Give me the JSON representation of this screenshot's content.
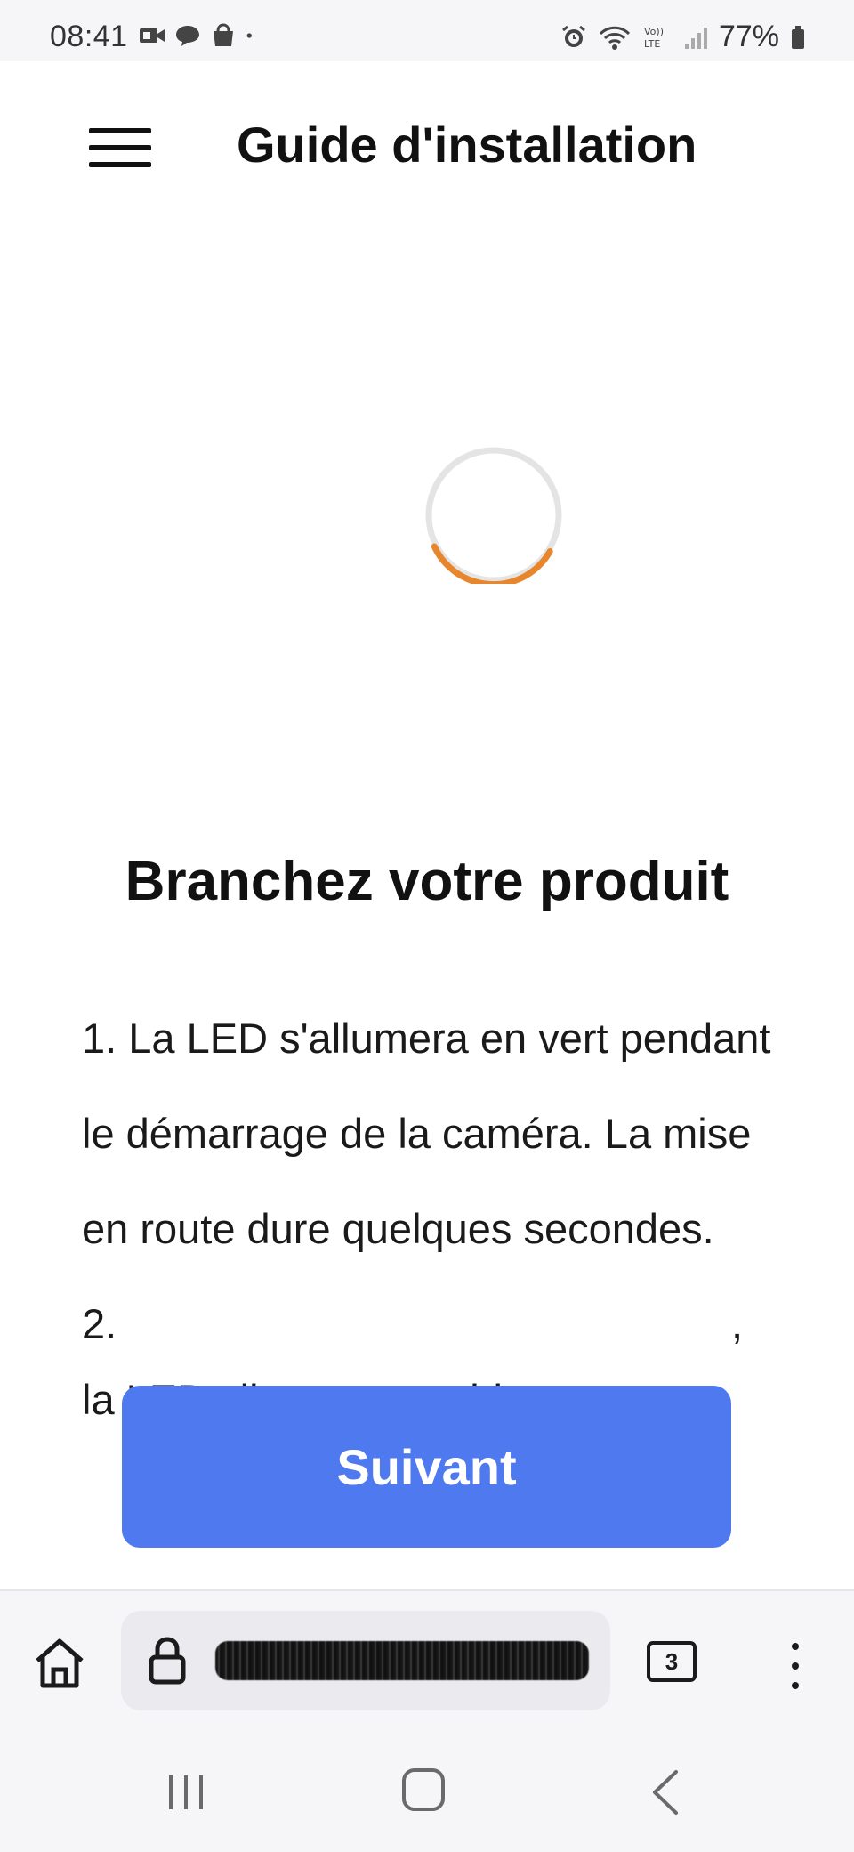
{
  "status_bar": {
    "time": "08:41",
    "battery": "77%",
    "left_icons": [
      "video-call-icon",
      "chat-bubble-icon",
      "shopping-bag-icon",
      "dot-icon"
    ],
    "right_icons": [
      "alarm-icon",
      "wifi-icon",
      "volte-icon",
      "signal-icon",
      "battery-icon"
    ]
  },
  "header": {
    "title": "Guide d'installation",
    "menu_icon": "hamburger-menu-icon"
  },
  "spinner": {
    "icon": "loading-spinner-icon",
    "track_color": "#e4e4e4",
    "arc_color": "#e8862c"
  },
  "content": {
    "section_title": "Branchez votre produit",
    "step1": "1. La LED s'allumera en vert pendant le démarrage de la caméra. La mise en route dure quelques secondes.",
    "step2_start": "2.",
    "step2_end": ",",
    "step2_line2": "la LED clignotera en blanc."
  },
  "next_button": {
    "label": "Suivant",
    "color": "#4f79ee"
  },
  "browser_bar": {
    "url": "redacted-url",
    "tab_count": "3",
    "icons": [
      "home-icon",
      "lock-icon",
      "more-vertical-icon"
    ]
  },
  "nav_bar": {
    "icons": [
      "recents-icon",
      "home-square-icon",
      "back-icon"
    ]
  }
}
